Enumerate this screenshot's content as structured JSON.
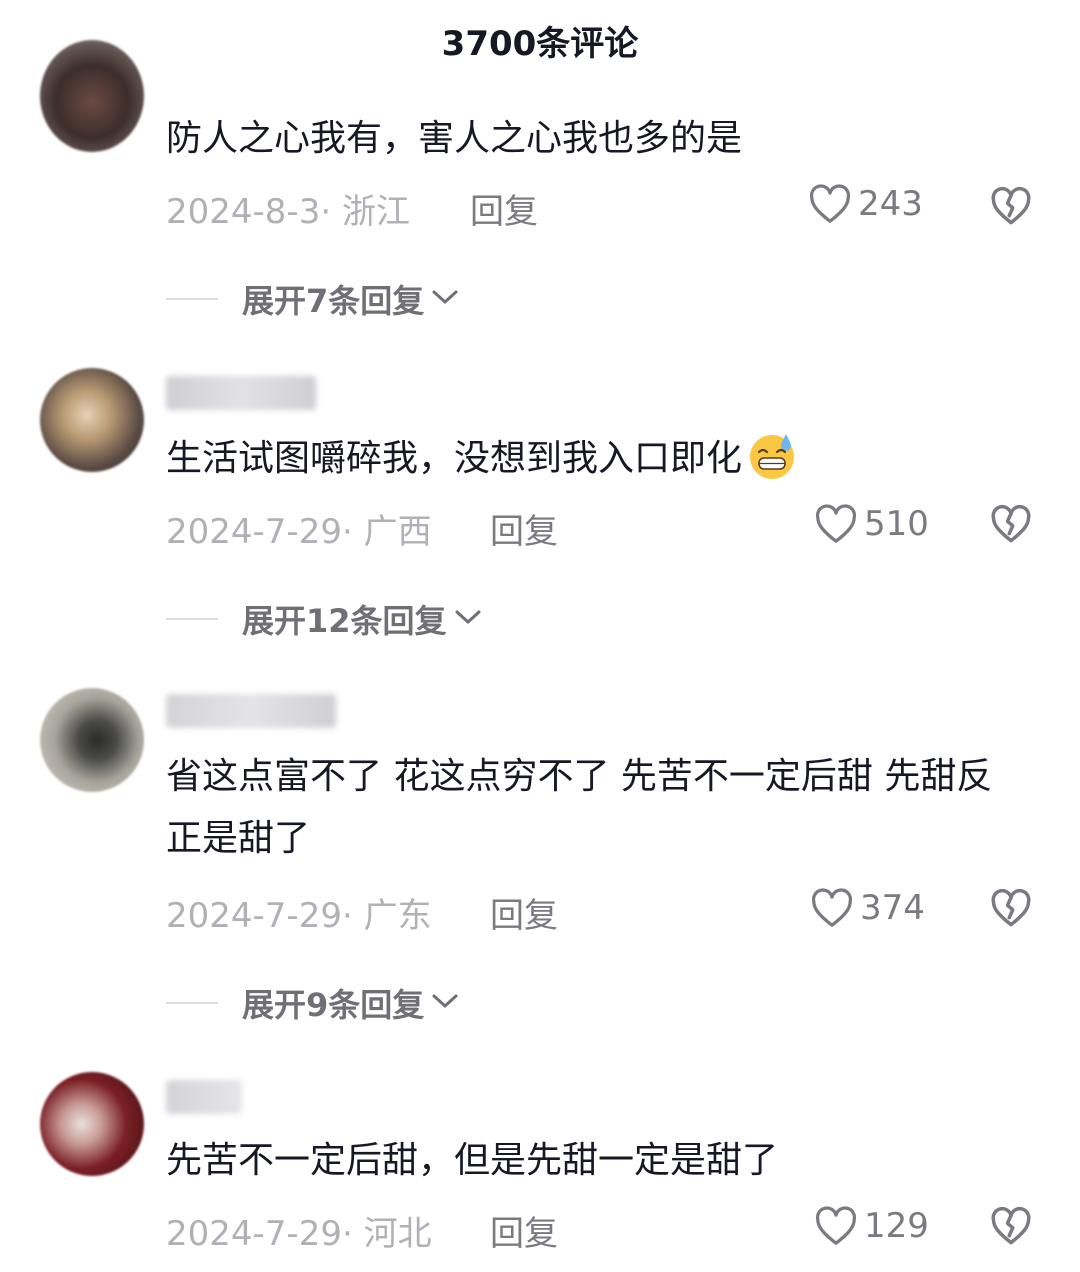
{
  "header": {
    "title": "3700条评论"
  },
  "comments": [
    {
      "text": "防人之心我有，害人之心我也多的是",
      "date": "2024-8-3",
      "location": "浙江",
      "reply_label": "回复",
      "likes": "243",
      "expand_label": "展开7条回复"
    },
    {
      "text": "生活试图嚼碎我，没想到我入口即化",
      "emoji": "grinning-sweat-emoji",
      "date": "2024-7-29",
      "location": "广西",
      "reply_label": "回复",
      "likes": "510",
      "expand_label": "展开12条回复"
    },
    {
      "text": "省这点富不了  花这点穷不了 先苦不一定后甜 先甜反正是甜了",
      "date": "2024-7-29",
      "location": "广东",
      "reply_label": "回复",
      "likes": "374",
      "expand_label": "展开9条回复"
    },
    {
      "text": "先苦不一定后甜，但是先甜一定是甜了",
      "date": "2024-7-29",
      "location": "河北",
      "reply_label": "回复",
      "likes": "129"
    }
  ],
  "icons": {
    "like": "heart-outline-icon",
    "dislike": "broken-heart-icon",
    "expand": "chevron-down-icon"
  },
  "colors": {
    "text": "#161823",
    "meta": "#b0b0b6",
    "action": "#7a7a80",
    "expand": "#6f6f75"
  }
}
